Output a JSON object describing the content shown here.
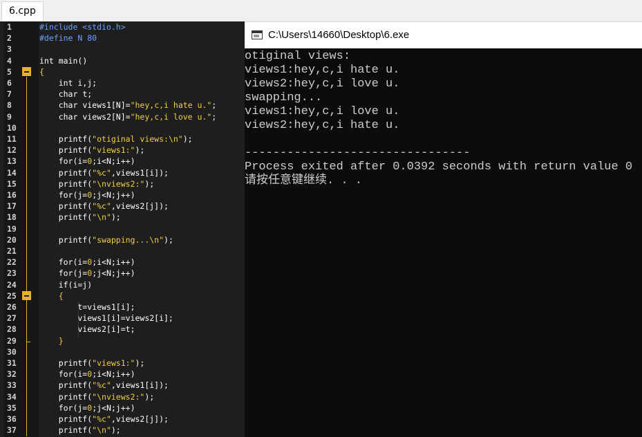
{
  "tab": {
    "label": "6.cpp"
  },
  "editor": {
    "lines": [
      {
        "n": "1",
        "t": [
          [
            "pp",
            "#include <stdio.h>"
          ]
        ]
      },
      {
        "n": "2",
        "t": [
          [
            "pp",
            "#define N 80"
          ]
        ]
      },
      {
        "n": "3",
        "t": []
      },
      {
        "n": "4",
        "t": [
          [
            "kw",
            "int"
          ],
          [
            "nm",
            " main()"
          ]
        ]
      },
      {
        "n": "5",
        "t": [
          [
            "st",
            "{"
          ]
        ]
      },
      {
        "n": "6",
        "t": [
          [
            "nm",
            "    "
          ],
          [
            "kw",
            "int"
          ],
          [
            "nm",
            " i,j;"
          ]
        ]
      },
      {
        "n": "7",
        "t": [
          [
            "nm",
            "    "
          ],
          [
            "kw",
            "char"
          ],
          [
            "nm",
            " t;"
          ]
        ]
      },
      {
        "n": "8",
        "t": [
          [
            "nm",
            "    "
          ],
          [
            "kw",
            "char"
          ],
          [
            "nm",
            " views1[N]="
          ],
          [
            "st",
            "\"hey,c,i hate u.\""
          ],
          [
            "nm",
            ";"
          ]
        ]
      },
      {
        "n": "9",
        "t": [
          [
            "nm",
            "    "
          ],
          [
            "kw",
            "char"
          ],
          [
            "nm",
            " views2[N]="
          ],
          [
            "st",
            "\"hey,c,i love u.\""
          ],
          [
            "nm",
            ";"
          ]
        ]
      },
      {
        "n": "10",
        "t": []
      },
      {
        "n": "11",
        "t": [
          [
            "nm",
            "    printf("
          ],
          [
            "st",
            "\"otiginal views:\\n\""
          ],
          [
            "nm",
            ");"
          ]
        ]
      },
      {
        "n": "12",
        "t": [
          [
            "nm",
            "    printf("
          ],
          [
            "st",
            "\"views1:\""
          ],
          [
            "nm",
            ");"
          ]
        ]
      },
      {
        "n": "13",
        "t": [
          [
            "nm",
            "    for(i="
          ],
          [
            "st",
            "0"
          ],
          [
            "nm",
            ";i<N;i++)"
          ]
        ]
      },
      {
        "n": "14",
        "t": [
          [
            "nm",
            "    printf("
          ],
          [
            "st",
            "\"%c\""
          ],
          [
            "nm",
            ",views1[i]);"
          ]
        ]
      },
      {
        "n": "15",
        "t": [
          [
            "nm",
            "    printf("
          ],
          [
            "st",
            "\"\\nviews2:\""
          ],
          [
            "nm",
            ");"
          ]
        ]
      },
      {
        "n": "16",
        "t": [
          [
            "nm",
            "    for(j="
          ],
          [
            "st",
            "0"
          ],
          [
            "nm",
            ";j<N;j++)"
          ]
        ]
      },
      {
        "n": "17",
        "t": [
          [
            "nm",
            "    printf("
          ],
          [
            "st",
            "\"%c\""
          ],
          [
            "nm",
            ",views2[j]);"
          ]
        ]
      },
      {
        "n": "18",
        "t": [
          [
            "nm",
            "    printf("
          ],
          [
            "st",
            "\"\\n\""
          ],
          [
            "nm",
            ");"
          ]
        ]
      },
      {
        "n": "19",
        "t": []
      },
      {
        "n": "20",
        "t": [
          [
            "nm",
            "    printf("
          ],
          [
            "st",
            "\"swapping...\\n\""
          ],
          [
            "nm",
            ");"
          ]
        ]
      },
      {
        "n": "21",
        "t": []
      },
      {
        "n": "22",
        "t": [
          [
            "nm",
            "    for(i="
          ],
          [
            "st",
            "0"
          ],
          [
            "nm",
            ";i<N;i++)"
          ]
        ]
      },
      {
        "n": "23",
        "t": [
          [
            "nm",
            "    for(j="
          ],
          [
            "st",
            "0"
          ],
          [
            "nm",
            ";j<N;j++)"
          ]
        ]
      },
      {
        "n": "24",
        "t": [
          [
            "nm",
            "    if(i=j)"
          ]
        ]
      },
      {
        "n": "25",
        "t": [
          [
            "st",
            "    {"
          ]
        ]
      },
      {
        "n": "26",
        "t": [
          [
            "nm",
            "        t=views1[i];"
          ]
        ]
      },
      {
        "n": "27",
        "t": [
          [
            "nm",
            "        views1[i]=views2[i];"
          ]
        ]
      },
      {
        "n": "28",
        "t": [
          [
            "nm",
            "        views2[i]=t;"
          ]
        ]
      },
      {
        "n": "29",
        "t": [
          [
            "st",
            "    }"
          ]
        ]
      },
      {
        "n": "30",
        "t": []
      },
      {
        "n": "31",
        "t": [
          [
            "nm",
            "    printf("
          ],
          [
            "st",
            "\"views1:\""
          ],
          [
            "nm",
            ");"
          ]
        ]
      },
      {
        "n": "32",
        "t": [
          [
            "nm",
            "    for(i="
          ],
          [
            "st",
            "0"
          ],
          [
            "nm",
            ";i<N;i++)"
          ]
        ]
      },
      {
        "n": "33",
        "t": [
          [
            "nm",
            "    printf("
          ],
          [
            "st",
            "\"%c\""
          ],
          [
            "nm",
            ",views1[i]);"
          ]
        ]
      },
      {
        "n": "34",
        "t": [
          [
            "nm",
            "    printf("
          ],
          [
            "st",
            "\"\\nviews2:\""
          ],
          [
            "nm",
            ");"
          ]
        ]
      },
      {
        "n": "35",
        "t": [
          [
            "nm",
            "    for(j="
          ],
          [
            "st",
            "0"
          ],
          [
            "nm",
            ";j<N;j++)"
          ]
        ]
      },
      {
        "n": "36",
        "t": [
          [
            "nm",
            "    printf("
          ],
          [
            "st",
            "\"%c\""
          ],
          [
            "nm",
            ",views2[j]);"
          ]
        ]
      },
      {
        "n": "37",
        "t": [
          [
            "nm",
            "    printf("
          ],
          [
            "st",
            "\"\\n\""
          ],
          [
            "nm",
            ");"
          ]
        ]
      }
    ]
  },
  "console": {
    "title": "C:\\Users\\14660\\Desktop\\6.exe",
    "lines": [
      "otiginal views:",
      "views1:hey,c,i hate u.",
      "views2:hey,c,i love u.",
      "swapping...",
      "views1:hey,c,i love u.",
      "views2:hey,c,i hate u.",
      "",
      "--------------------------------",
      "Process exited after 0.0392 seconds with return value 0",
      "请按任意键继续. . ."
    ]
  }
}
